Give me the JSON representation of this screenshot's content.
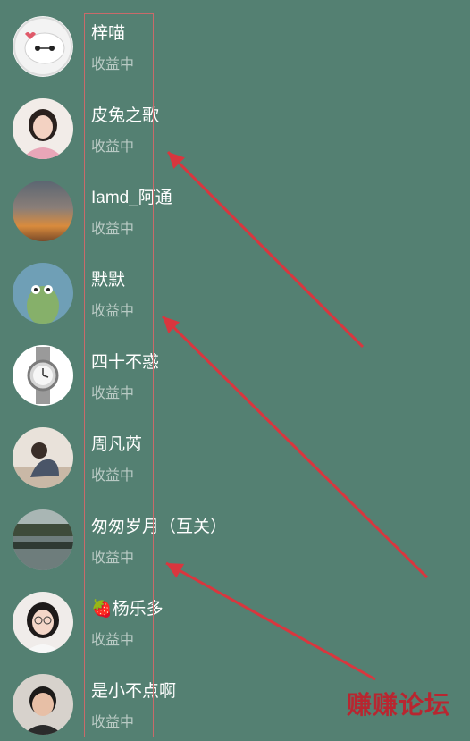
{
  "contacts": [
    {
      "name": "梓喵",
      "status": "收益中",
      "avatar": "baymax-avatar"
    },
    {
      "name": "皮兔之歌",
      "status": "收益中",
      "avatar": "girl-avatar"
    },
    {
      "name": "Iamd_阿通",
      "status": "收益中",
      "avatar": "sunset-avatar"
    },
    {
      "name": "默默",
      "status": "收益中",
      "avatar": "frog-avatar"
    },
    {
      "name": "四十不惑",
      "status": "收益中",
      "avatar": "watch-avatar"
    },
    {
      "name": "周凡芮",
      "status": "收益中",
      "avatar": "woman-sitting-avatar"
    },
    {
      "name": "匆匆岁月（互关）",
      "status": "收益中",
      "avatar": "lake-avatar"
    },
    {
      "name": "🍓杨乐多",
      "status": "收益中",
      "avatar": "woman-glasses-avatar"
    },
    {
      "name": "是小不点啊",
      "status": "收益中",
      "avatar": "boy-avatar"
    }
  ],
  "watermark": "赚赚论坛",
  "colors": {
    "background": "#548072",
    "annotation": "#d9363e"
  }
}
